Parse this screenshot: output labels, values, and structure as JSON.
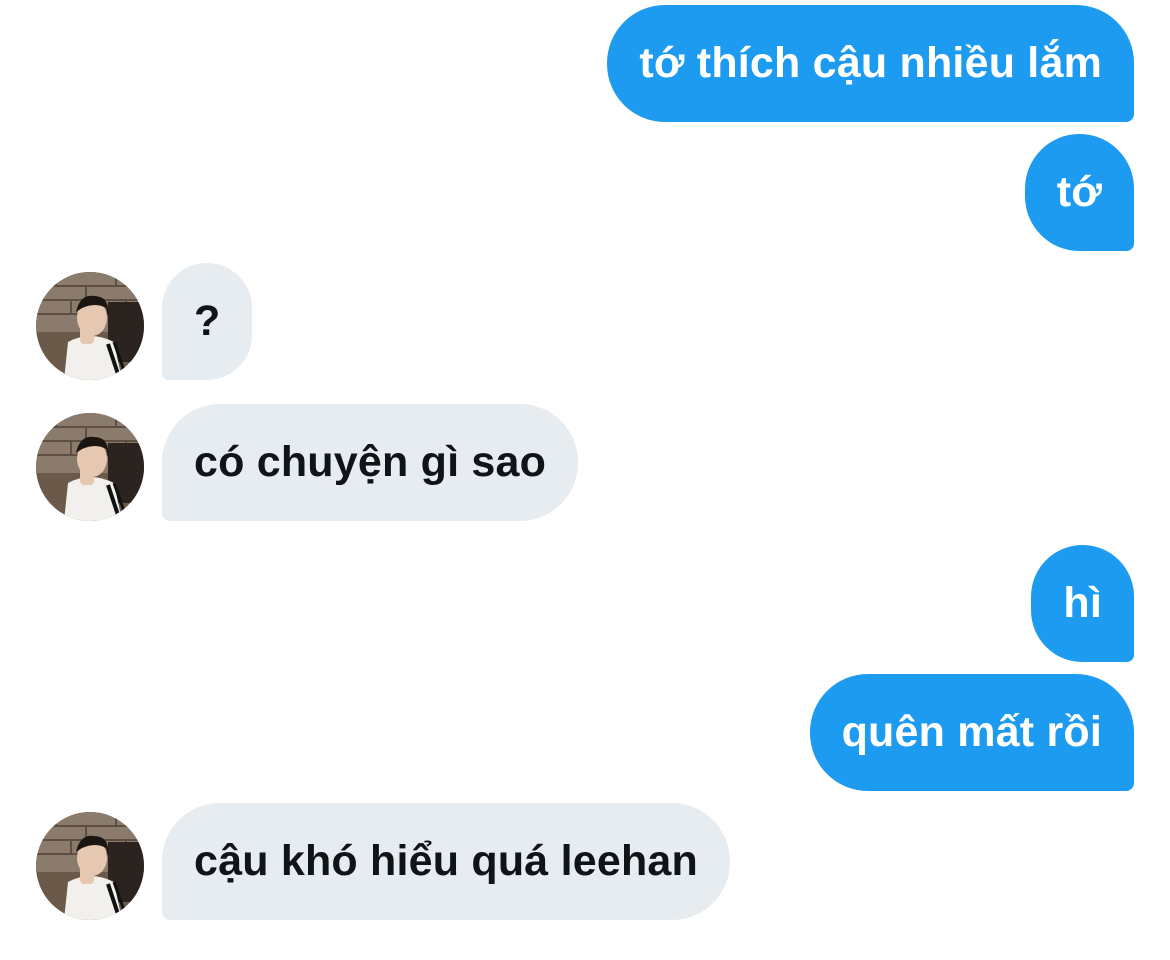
{
  "conversation": {
    "messages": [
      {
        "sender": "me",
        "text": "tớ thích cậu nhiều lắm"
      },
      {
        "sender": "me",
        "text": "tớ"
      },
      {
        "sender": "them",
        "text": "?",
        "avatar": "profile-photo"
      },
      {
        "sender": "them",
        "text": "có chuyện gì sao",
        "avatar": "profile-photo"
      },
      {
        "sender": "me",
        "text": "hì"
      },
      {
        "sender": "me",
        "text": "quên mất rồi"
      },
      {
        "sender": "them",
        "text": "cậu khó hiểu quá leehan",
        "avatar": "profile-photo"
      }
    ]
  },
  "colors": {
    "outgoing_bubble": "#1d9bf0",
    "outgoing_text": "#ffffff",
    "incoming_bubble": "#e7ecf0",
    "incoming_text": "#0f1419",
    "background": "#ffffff"
  }
}
